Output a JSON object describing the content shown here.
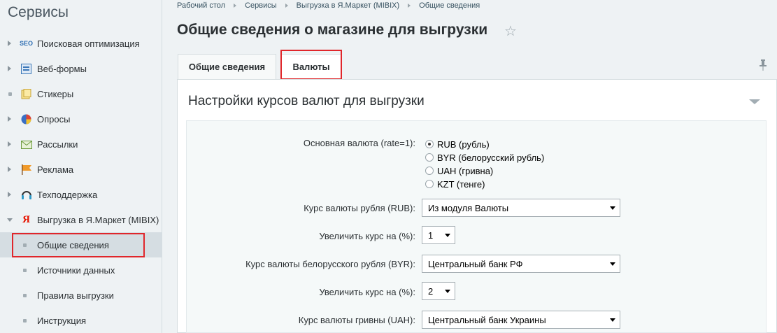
{
  "sidebar": {
    "title": "Сервисы",
    "items": [
      {
        "label": "Поисковая оптимизация",
        "icon": "seo-icon"
      },
      {
        "label": "Веб-формы",
        "icon": "webforms-icon"
      },
      {
        "label": "Стикеры",
        "icon": "stickers-icon"
      },
      {
        "label": "Опросы",
        "icon": "polls-icon"
      },
      {
        "label": "Рассылки",
        "icon": "mailing-icon"
      },
      {
        "label": "Реклама",
        "icon": "advertising-icon"
      },
      {
        "label": "Техподдержка",
        "icon": "support-icon"
      },
      {
        "label": "Выгрузка в Я.Маркет (MIBIX)",
        "icon": "yandex-icon"
      }
    ],
    "subitems": [
      {
        "label": "Общие сведения"
      },
      {
        "label": "Источники данных"
      },
      {
        "label": "Правила выгрузки"
      },
      {
        "label": "Инструкция"
      }
    ]
  },
  "breadcrumb": [
    "Рабочий стол",
    "Сервисы",
    "Выгрузка в Я.Маркет (MIBIX)",
    "Общие сведения"
  ],
  "page_title": "Общие сведения о магазине для выгрузки",
  "tabs": [
    {
      "label": "Общие сведения"
    },
    {
      "label": "Валюты"
    }
  ],
  "section": {
    "title": "Настройки курсов валют для выгрузки"
  },
  "form": {
    "base_currency_label": "Основная валюта (rate=1):",
    "base_currency_options": [
      "RUB (рубль)",
      "BYR (белорусский рубль)",
      "UAH (гривна)",
      "KZT (тенге)"
    ],
    "rub_rate_label": "Курс валюты рубля (RUB):",
    "rub_rate_value": "Из модуля Валюты",
    "rub_increase_label": "Увеличить курс на (%):",
    "rub_increase_value": "1",
    "byr_rate_label": "Курс валюты белорусского рубля (BYR):",
    "byr_rate_value": "Центральный банк РФ",
    "byr_increase_label": "Увеличить курс на (%):",
    "byr_increase_value": "2",
    "uah_rate_label": "Курс валюты гривны (UAH):",
    "uah_rate_value": "Центральный банк Украины"
  }
}
